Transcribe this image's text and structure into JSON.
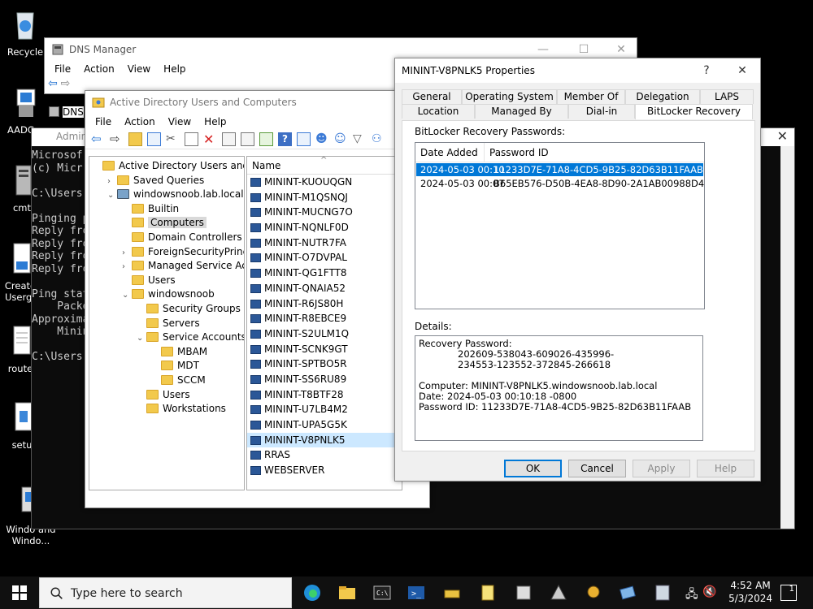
{
  "desktop": {
    "icons": [
      {
        "label": "Recycle"
      },
      {
        "label": "AADCo"
      },
      {
        "label": "cmt"
      },
      {
        "label": "Create Usergr"
      },
      {
        "label": "route"
      },
      {
        "label": "setu"
      },
      {
        "label": "Windo and Windo..."
      }
    ]
  },
  "console": {
    "title": "Admin",
    "lines": "Microsof\n(c) Micr\n\nC:\\Users\n\nPinging p\nReply fro\nReply fro\nReply fro\nReply fro\n\nPing stat\n    Packe\nApproxima\n    Minin\n\nC:\\Users"
  },
  "dns": {
    "title": "DNS Manager",
    "menu": [
      "File",
      "Action",
      "View",
      "Help"
    ],
    "tree_item": "DNS",
    "minimize": "—",
    "maximize": "☐",
    "close": "✕"
  },
  "aduc": {
    "title": "Active Directory Users and Computers",
    "menu": [
      "File",
      "Action",
      "View",
      "Help"
    ],
    "tree": [
      {
        "label": "Active Directory Users and Com",
        "indent": 0,
        "exp": ""
      },
      {
        "label": "Saved Queries",
        "indent": 1,
        "exp": ">"
      },
      {
        "label": "windowsnoob.lab.local",
        "indent": 1,
        "exp": "v"
      },
      {
        "label": "Builtin",
        "indent": 2,
        "exp": ""
      },
      {
        "label": "Computers",
        "indent": 2,
        "exp": "",
        "selected": true
      },
      {
        "label": "Domain Controllers",
        "indent": 2,
        "exp": ""
      },
      {
        "label": "ForeignSecurityPrincipals",
        "indent": 2,
        "exp": ">"
      },
      {
        "label": "Managed Service Accour",
        "indent": 2,
        "exp": ">"
      },
      {
        "label": "Users",
        "indent": 2,
        "exp": ""
      },
      {
        "label": "windowsnoob",
        "indent": 2,
        "exp": "v"
      },
      {
        "label": "Security Groups",
        "indent": 3,
        "exp": ""
      },
      {
        "label": "Servers",
        "indent": 3,
        "exp": ""
      },
      {
        "label": "Service Accounts",
        "indent": 3,
        "exp": "v"
      },
      {
        "label": "MBAM",
        "indent": 4,
        "exp": ""
      },
      {
        "label": "MDT",
        "indent": 4,
        "exp": ""
      },
      {
        "label": "SCCM",
        "indent": 4,
        "exp": ""
      },
      {
        "label": "Users",
        "indent": 3,
        "exp": ""
      },
      {
        "label": "Workstations",
        "indent": 3,
        "exp": ""
      }
    ],
    "list_header": "Name",
    "computers": [
      {
        "name": "MININT-KUOUQGN"
      },
      {
        "name": "MININT-M1QSNQJ"
      },
      {
        "name": "MININT-MUCNG7O"
      },
      {
        "name": "MININT-NQNLF0D"
      },
      {
        "name": "MININT-NUTR7FA"
      },
      {
        "name": "MININT-O7DVPAL"
      },
      {
        "name": "MININT-QG1FTT8"
      },
      {
        "name": "MININT-QNAIA52"
      },
      {
        "name": "MININT-R6JS80H"
      },
      {
        "name": "MININT-R8EBCE9"
      },
      {
        "name": "MININT-S2ULM1Q"
      },
      {
        "name": "MININT-SCNK9GT"
      },
      {
        "name": "MININT-SPTBO5R"
      },
      {
        "name": "MININT-SS6RU89"
      },
      {
        "name": "MININT-T8BTF28"
      },
      {
        "name": "MININT-U7LB4M2"
      },
      {
        "name": "MININT-UPA5G5K"
      },
      {
        "name": "MININT-V8PNLK5",
        "selected": true
      },
      {
        "name": "RRAS"
      },
      {
        "name": "WEBSERVER"
      }
    ]
  },
  "props": {
    "title": "MININT-V8PNLK5 Properties",
    "help_btn": "?",
    "close_btn": "✕",
    "tabs_row1": [
      "General",
      "Operating System",
      "Member Of",
      "Delegation",
      "LAPS"
    ],
    "tabs_row2": [
      "Location",
      "Managed By",
      "Dial-in",
      "BitLocker Recovery"
    ],
    "active_tab": "BitLocker Recovery",
    "passwords_label": "BitLocker Recovery Passwords:",
    "columns": [
      "Date Added",
      "Password ID"
    ],
    "rows": [
      {
        "date": "2024-05-03 00:10",
        "id": "11233D7E-71A8-4CD5-9B25-82D63B11FAAB",
        "selected": true
      },
      {
        "date": "2024-05-03 00:07",
        "id": "B65EB576-D50B-4EA8-8D90-2A1AB00988D4"
      }
    ],
    "details_label": "Details:",
    "details": {
      "recovery_label": "Recovery Password:",
      "recovery_line1": "202609-538043-609026-435996-",
      "recovery_line2": "234553-123552-372845-266618",
      "computer": "Computer: MININT-V8PNLK5.windowsnoob.lab.local",
      "date": "Date: 2024-05-03 00:10:18 -0800",
      "password_id": "Password ID: 11233D7E-71A8-4CD5-9B25-82D63B11FAAB"
    },
    "buttons": {
      "ok": "OK",
      "cancel": "Cancel",
      "apply": "Apply",
      "help": "Help"
    }
  },
  "taskbar": {
    "search_placeholder": "Type here to search",
    "time": "4:52 AM",
    "date": "5/3/2024",
    "notification_count": "1"
  }
}
